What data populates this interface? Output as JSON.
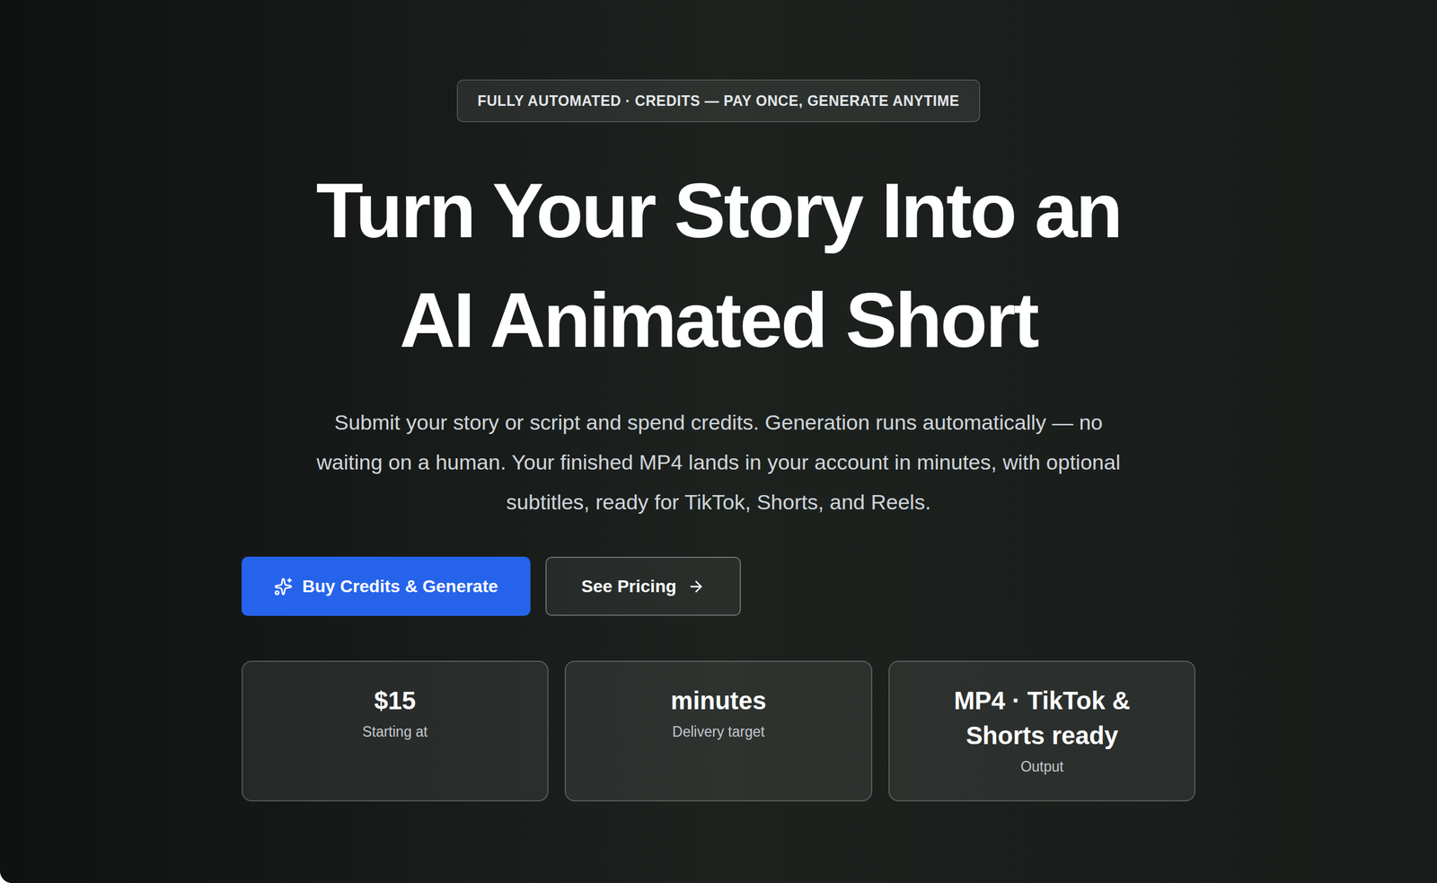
{
  "badge": "FULLY AUTOMATED · CREDITS — PAY ONCE, GENERATE ANYTIME",
  "heading": [
    "Turn Your Story Into an",
    "AI Animated Short"
  ],
  "description": "Submit your story or script and spend credits. Generation runs automatically — no waiting on a human. Your finished MP4 lands in your account in minutes, with optional subtitles, ready for TikTok, Shorts, and Reels.",
  "buttons": [
    {
      "label": "Buy Credits & Generate",
      "kind": "primary"
    },
    {
      "label": "See Pricing",
      "kind": "secondary"
    }
  ],
  "stats": [
    {
      "value": "$15",
      "label": "Starting at"
    },
    {
      "value": "minutes",
      "label": "Delivery target"
    },
    {
      "value": "MP4 · TikTok & Shorts ready",
      "label": "Output"
    }
  ]
}
